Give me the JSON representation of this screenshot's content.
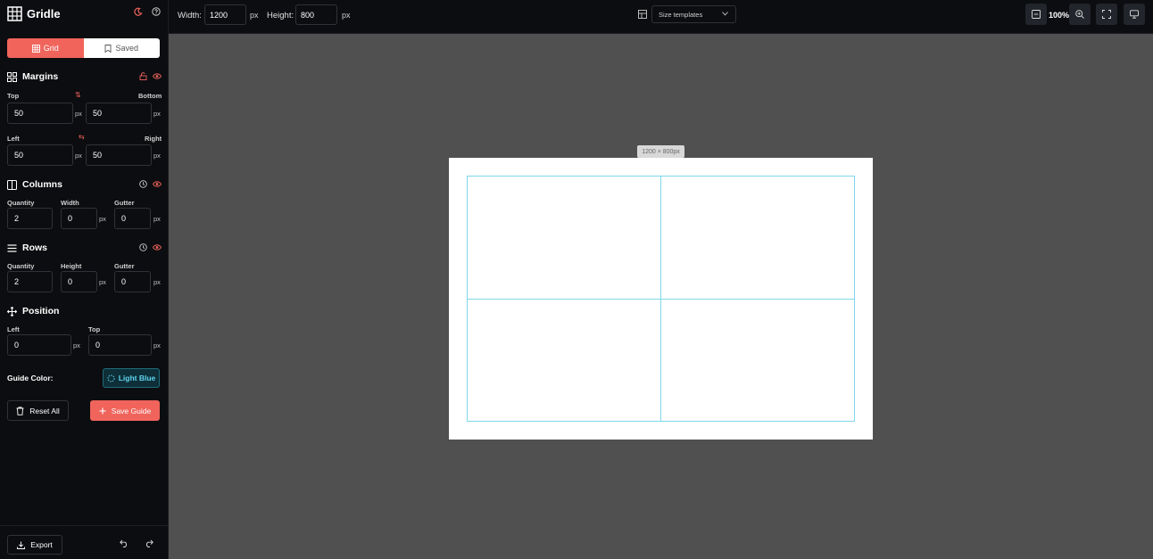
{
  "app": {
    "name": "Gridle"
  },
  "mode_tabs": {
    "grid": "Grid",
    "saved": "Saved"
  },
  "margins": {
    "title": "Margins",
    "top_label": "Top",
    "top_value": "50",
    "bottom_label": "Bottom",
    "bottom_value": "50",
    "left_label": "Left",
    "left_value": "50",
    "right_label": "Right",
    "right_value": "50",
    "unit": "px"
  },
  "columns": {
    "title": "Columns",
    "quantity_label": "Quantity",
    "quantity_value": "2",
    "width_label": "Width",
    "width_value": "0",
    "gutter_label": "Gutter",
    "gutter_value": "0",
    "unit": "px"
  },
  "rows": {
    "title": "Rows",
    "quantity_label": "Quantity",
    "quantity_value": "2",
    "height_label": "Height",
    "height_value": "0",
    "gutter_label": "Gutter",
    "gutter_value": "0",
    "unit": "px"
  },
  "position": {
    "title": "Position",
    "left_label": "Left",
    "left_value": "0",
    "top_label": "Top",
    "top_value": "0",
    "unit": "px"
  },
  "guide_color": {
    "label": "Guide Color:",
    "value": "Light Blue",
    "hex": "#7fd7ea"
  },
  "actions": {
    "reset": "Reset All",
    "save": "Save Guide",
    "export": "Export"
  },
  "toolbar": {
    "width_label": "Width:",
    "width_value": "1200",
    "height_label": "Height:",
    "height_value": "800",
    "unit": "px",
    "templates_label": "Size templates",
    "zoom": "100%"
  },
  "canvas": {
    "size_label": "1200 × 800px",
    "columns": 2,
    "rows": 2
  },
  "colors": {
    "accent": "#f0645c",
    "sidebar_bg": "#0c0d10",
    "canvas_bg": "#505050",
    "guide": "#7fd7ea"
  }
}
